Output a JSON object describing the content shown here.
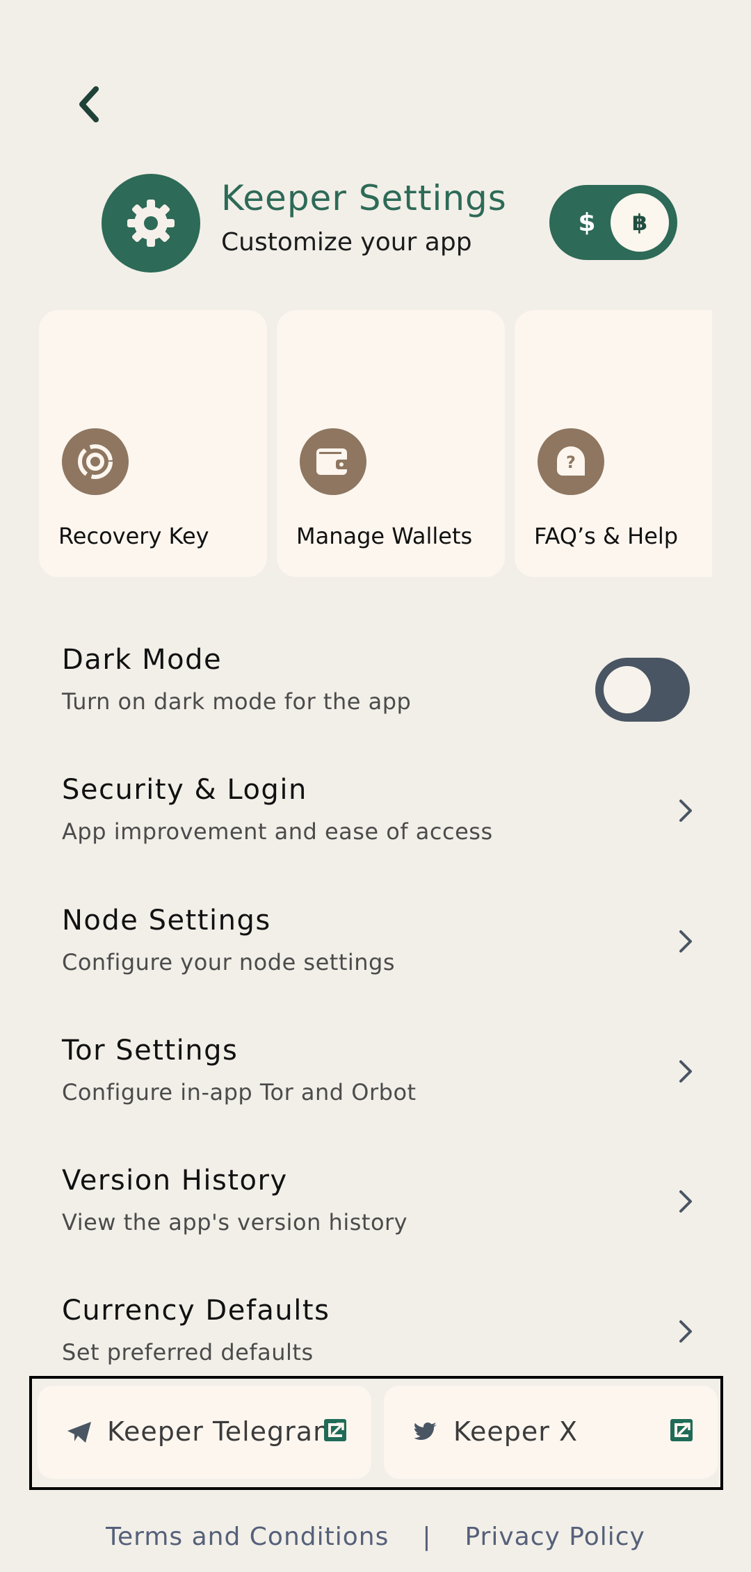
{
  "header": {
    "title": "Keeper Settings",
    "subtitle": "Customize your app",
    "currency_left": "$",
    "currency_right": "฿"
  },
  "cards": [
    {
      "label": "Recovery Key",
      "icon": "recovery-key-icon"
    },
    {
      "label": "Manage Wallets",
      "icon": "wallet-icon"
    },
    {
      "label": "FAQ’s & Help",
      "icon": "help-icon"
    }
  ],
  "settings": [
    {
      "title": "Dark Mode",
      "subtitle": "Turn on dark mode for the app"
    },
    {
      "title": "Security & Login",
      "subtitle": "App improvement and ease of access"
    },
    {
      "title": "Node Settings",
      "subtitle": "Configure your node settings"
    },
    {
      "title": "Tor Settings",
      "subtitle": "Configure in-app Tor and Orbot"
    },
    {
      "title": "Version History",
      "subtitle": "View the app's version history"
    },
    {
      "title": "Currency Defaults",
      "subtitle": "Set preferred defaults"
    }
  ],
  "links": {
    "telegram": "Keeper Telegram",
    "x": "Keeper X"
  },
  "footer": {
    "terms": "Terms and Conditions",
    "separator": "|",
    "privacy": "Privacy Policy"
  },
  "colors": {
    "background": "#F2EFE8",
    "brand_green": "#2D6A57",
    "card_bg": "#FCF6EF",
    "card_icon_brown": "#8E7660",
    "toggle_off": "#4A5563",
    "footer_text": "#55607A"
  }
}
